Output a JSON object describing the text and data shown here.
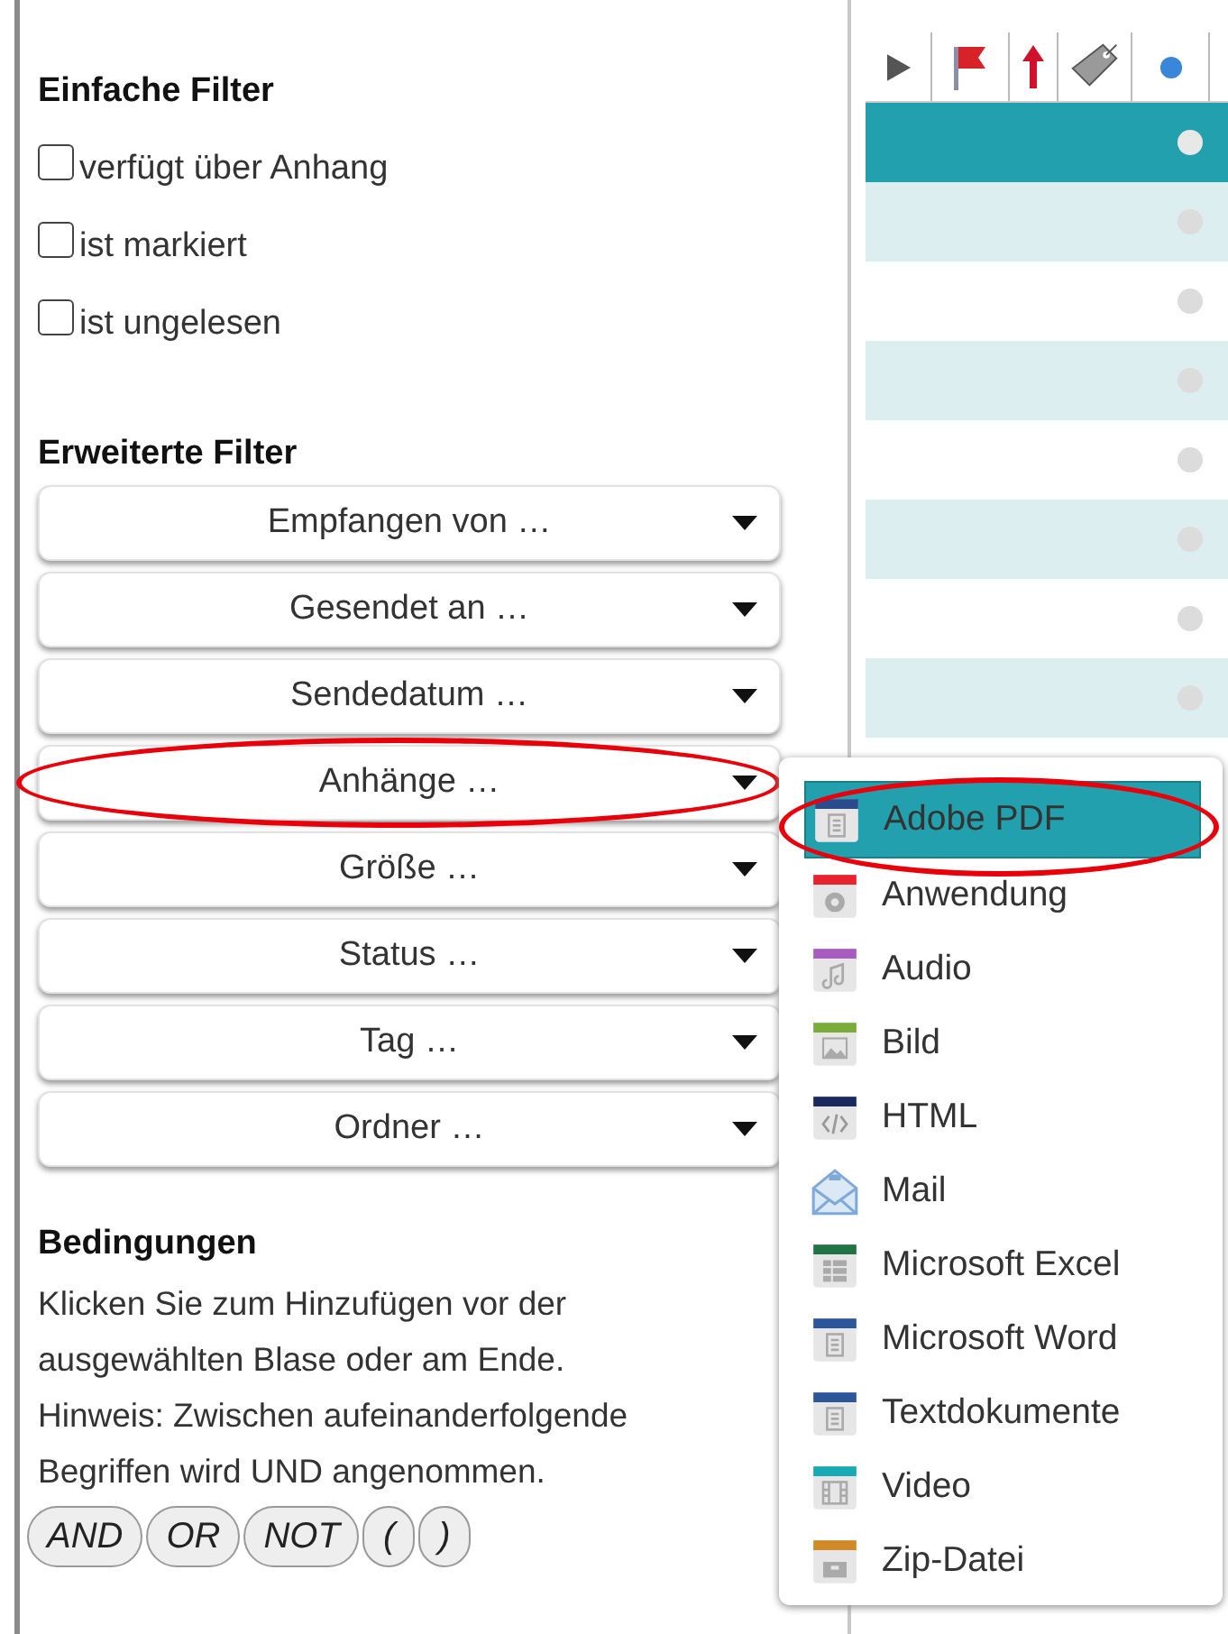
{
  "simple_filters": {
    "title": "Einfache Filter",
    "options": [
      {
        "label": "verfügt über Anhang",
        "checked": false
      },
      {
        "label": "ist markiert",
        "checked": false
      },
      {
        "label": "ist ungelesen",
        "checked": false
      }
    ]
  },
  "advanced_filters": {
    "title": "Erweiterte Filter",
    "dropdowns": [
      {
        "label": "Empfangen von …",
        "circled": false
      },
      {
        "label": "Gesendet an …",
        "circled": false
      },
      {
        "label": "Sendedatum …",
        "circled": false
      },
      {
        "label": "Anhänge …",
        "circled": true
      },
      {
        "label": "Größe …",
        "circled": false
      },
      {
        "label": "Status …",
        "circled": false
      },
      {
        "label": "Tag …",
        "circled": false
      },
      {
        "label": "Ordner …",
        "circled": false
      }
    ]
  },
  "conditions": {
    "title": "Bedingungen",
    "help": "Klicken Sie zum Hinzufügen vor der\nausgewählten Blase oder am Ende.\nHinweis: Zwischen aufeinanderfolgende\nBegriffen wird UND angenommen.",
    "operators": [
      "AND",
      "OR",
      "NOT",
      "(",
      ")"
    ]
  },
  "message_list": {
    "rows": [
      {
        "selected": true
      },
      {
        "selected": false
      },
      {
        "selected": false
      },
      {
        "selected": false
      },
      {
        "selected": false
      },
      {
        "selected": false
      },
      {
        "selected": false
      },
      {
        "selected": false
      }
    ]
  },
  "attachment_menu": {
    "items": [
      {
        "label": "Adobe PDF",
        "kind": "doc",
        "color": "#2b4c8c",
        "selected": true,
        "circled": true
      },
      {
        "label": "Anwendung",
        "kind": "gear",
        "color": "#e8232e",
        "selected": false,
        "circled": false
      },
      {
        "label": "Audio",
        "kind": "music",
        "color": "#a95cc0",
        "selected": false,
        "circled": false
      },
      {
        "label": "Bild",
        "kind": "image",
        "color": "#7aac3a",
        "selected": false,
        "circled": false
      },
      {
        "label": "HTML",
        "kind": "code",
        "color": "#1a2a5c",
        "selected": false,
        "circled": false
      },
      {
        "label": "Mail",
        "kind": "mail",
        "color": "#7fa9d8",
        "selected": false,
        "circled": false
      },
      {
        "label": "Microsoft Excel",
        "kind": "grid",
        "color": "#217346",
        "selected": false,
        "circled": false
      },
      {
        "label": "Microsoft Word",
        "kind": "doc",
        "color": "#2b579a",
        "selected": false,
        "circled": false
      },
      {
        "label": "Textdokumente",
        "kind": "doc",
        "color": "#2b579a",
        "selected": false,
        "circled": false
      },
      {
        "label": "Video",
        "kind": "film",
        "color": "#18a9b5",
        "selected": false,
        "circled": false
      },
      {
        "label": "Zip-Datei",
        "kind": "archive",
        "color": "#d08a28",
        "selected": false,
        "circled": false
      }
    ]
  }
}
